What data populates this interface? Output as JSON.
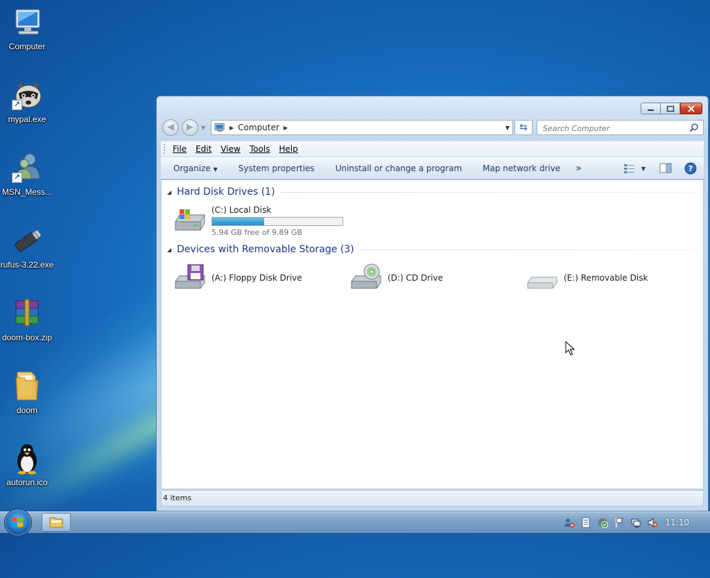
{
  "desktop": {
    "icons": [
      {
        "label": "Computer"
      },
      {
        "label": "mypal.exe"
      },
      {
        "label": "MSN_Mess..."
      },
      {
        "label": "rufus-3.22.exe"
      },
      {
        "label": "doom-box.zip"
      },
      {
        "label": "doom"
      },
      {
        "label": "autorun.ico"
      }
    ]
  },
  "window": {
    "address": {
      "location": "Computer"
    },
    "search": {
      "placeholder": "Search Computer"
    },
    "menu": [
      "File",
      "Edit",
      "View",
      "Tools",
      "Help"
    ],
    "commands": {
      "organize": "Organize",
      "system_properties": "System properties",
      "uninstall": "Uninstall or change a program",
      "map_drive": "Map network drive",
      "more": "»"
    },
    "groups": [
      {
        "title": "Hard Disk Drives (1)",
        "items": [
          {
            "name": "(C:) Local Disk",
            "free_text": "5.94 GB free of 9.89 GB",
            "used_fraction": 0.4
          }
        ]
      },
      {
        "title": "Devices with Removable Storage (3)",
        "items": [
          {
            "name": "(A:) Floppy Disk Drive"
          },
          {
            "name": "(D:) CD Drive"
          },
          {
            "name": "(E:) Removable Disk"
          }
        ]
      }
    ],
    "status": "4 items"
  },
  "taskbar": {
    "clock": "11:10"
  },
  "colors": {
    "group_heading": "#1e3287",
    "progress_fill": "#2290c9",
    "close_button": "#c9452c"
  }
}
